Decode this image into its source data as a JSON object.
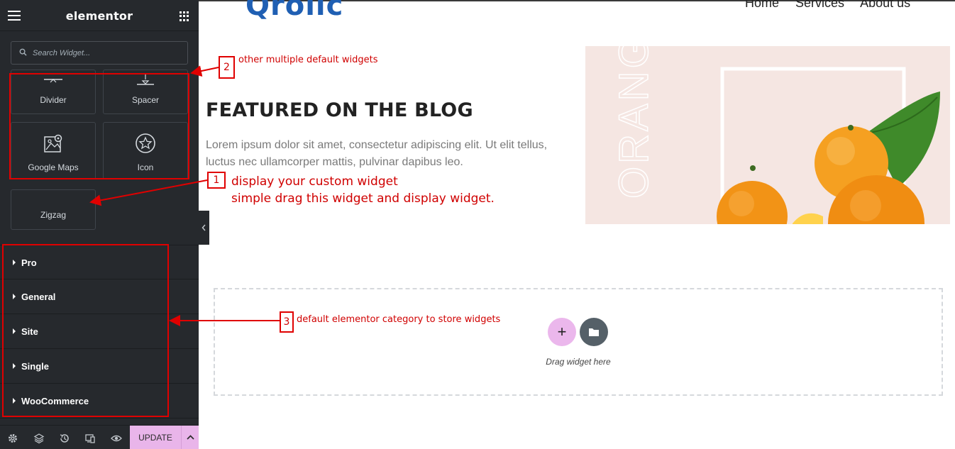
{
  "sidebar": {
    "brand": "elementor",
    "search_placeholder": "Search Widget...",
    "widgets": [
      {
        "label": "Divider",
        "icon": "divider-icon"
      },
      {
        "label": "Spacer",
        "icon": "spacer-icon"
      },
      {
        "label": "Google Maps",
        "icon": "map-icon"
      },
      {
        "label": "Icon",
        "icon": "star-icon"
      },
      {
        "label": "Zigzag",
        "icon": ""
      }
    ],
    "categories": [
      "Pro",
      "General",
      "Site",
      "Single",
      "WooCommerce"
    ],
    "footer": {
      "icons": [
        "gear-icon",
        "layers-icon",
        "history-icon",
        "responsive-icon",
        "eye-icon"
      ],
      "update_label": "UPDATE"
    }
  },
  "page": {
    "logo": "Qrolic",
    "nav": [
      "Home",
      "Services",
      "About us"
    ],
    "featured_title": "FEATURED ON THE BLOG",
    "featured_text": "Lorem ipsum dolor sit amet, consectetur adipiscing elit. Ut elit tellus, luctus nec ullamcorper mattis, pulvinar dapibus leo.",
    "hero_word": "ORANGE",
    "dropzone_text": "Drag widget here"
  },
  "annotations": {
    "a1_number": "1",
    "a1_line1": "display your custom widget",
    "a1_line2": "simple drag this widget and display widget.",
    "a2_number": "2",
    "a2_text": "other multiple default widgets",
    "a3_number": "3",
    "a3_text": "default elementor category to store widgets",
    "color": "#e00000"
  },
  "colors": {
    "sidebar_bg": "#26292d",
    "accent_pink": "#e9b5ea",
    "logo_blue": "#1f5fb3"
  }
}
